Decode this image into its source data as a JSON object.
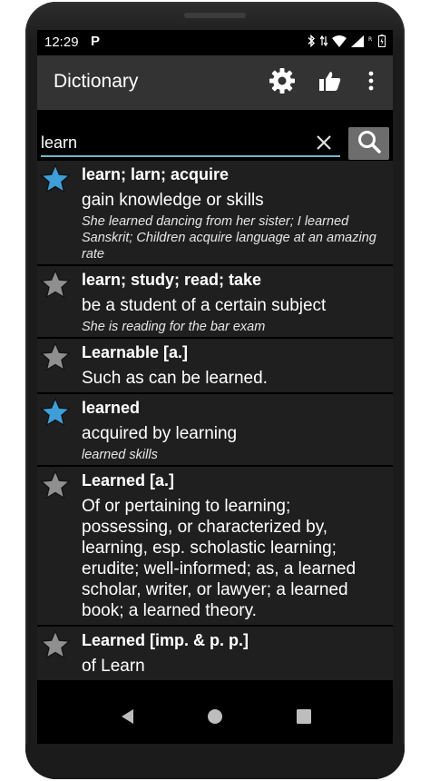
{
  "status": {
    "time": "12:29",
    "app_badge": "P"
  },
  "toolbar": {
    "title": "Dictionary",
    "settings_icon": "gear-icon",
    "rate_icon": "thumbs-up-icon",
    "menu_icon": "more-vert-icon"
  },
  "search": {
    "value": "learn",
    "clear_icon": "close-icon",
    "search_icon": "search-icon"
  },
  "colors": {
    "star_active": "#3d9ed8",
    "star_inactive": "#8f8f8f",
    "toolbar": "#333333",
    "row_bg": "#1f1f1f",
    "accent": "#6fb7c9"
  },
  "results": [
    {
      "favorited": true,
      "term": "learn; larn; acquire",
      "definition": "gain knowledge or skills",
      "example": "She learned dancing from her sister; I learned Sanskrit; Children acquire language at an amazing rate"
    },
    {
      "favorited": false,
      "term": "learn; study; read; take",
      "definition": "be a student of a certain subject",
      "example": "She is reading for the bar exam"
    },
    {
      "favorited": false,
      "term": "Learnable [a.]",
      "definition": "Such as can be learned.",
      "example": ""
    },
    {
      "favorited": true,
      "term": "learned",
      "definition": "acquired by learning",
      "example": "learned skills"
    },
    {
      "favorited": false,
      "term": "Learned [a.]",
      "definition": "Of or pertaining to learning; possessing, or characterized by, learning, esp. scholastic learning; erudite; well-informed; as, a learned scholar, writer, or lawyer; a learned book; a learned theory.",
      "example": ""
    },
    {
      "favorited": false,
      "term": "Learned [imp. & p. p.]",
      "definition": "of Learn",
      "example": ""
    }
  ],
  "nav": {
    "back_icon": "back-triangle-icon",
    "home_icon": "home-circle-icon",
    "recents_icon": "recents-square-icon"
  }
}
